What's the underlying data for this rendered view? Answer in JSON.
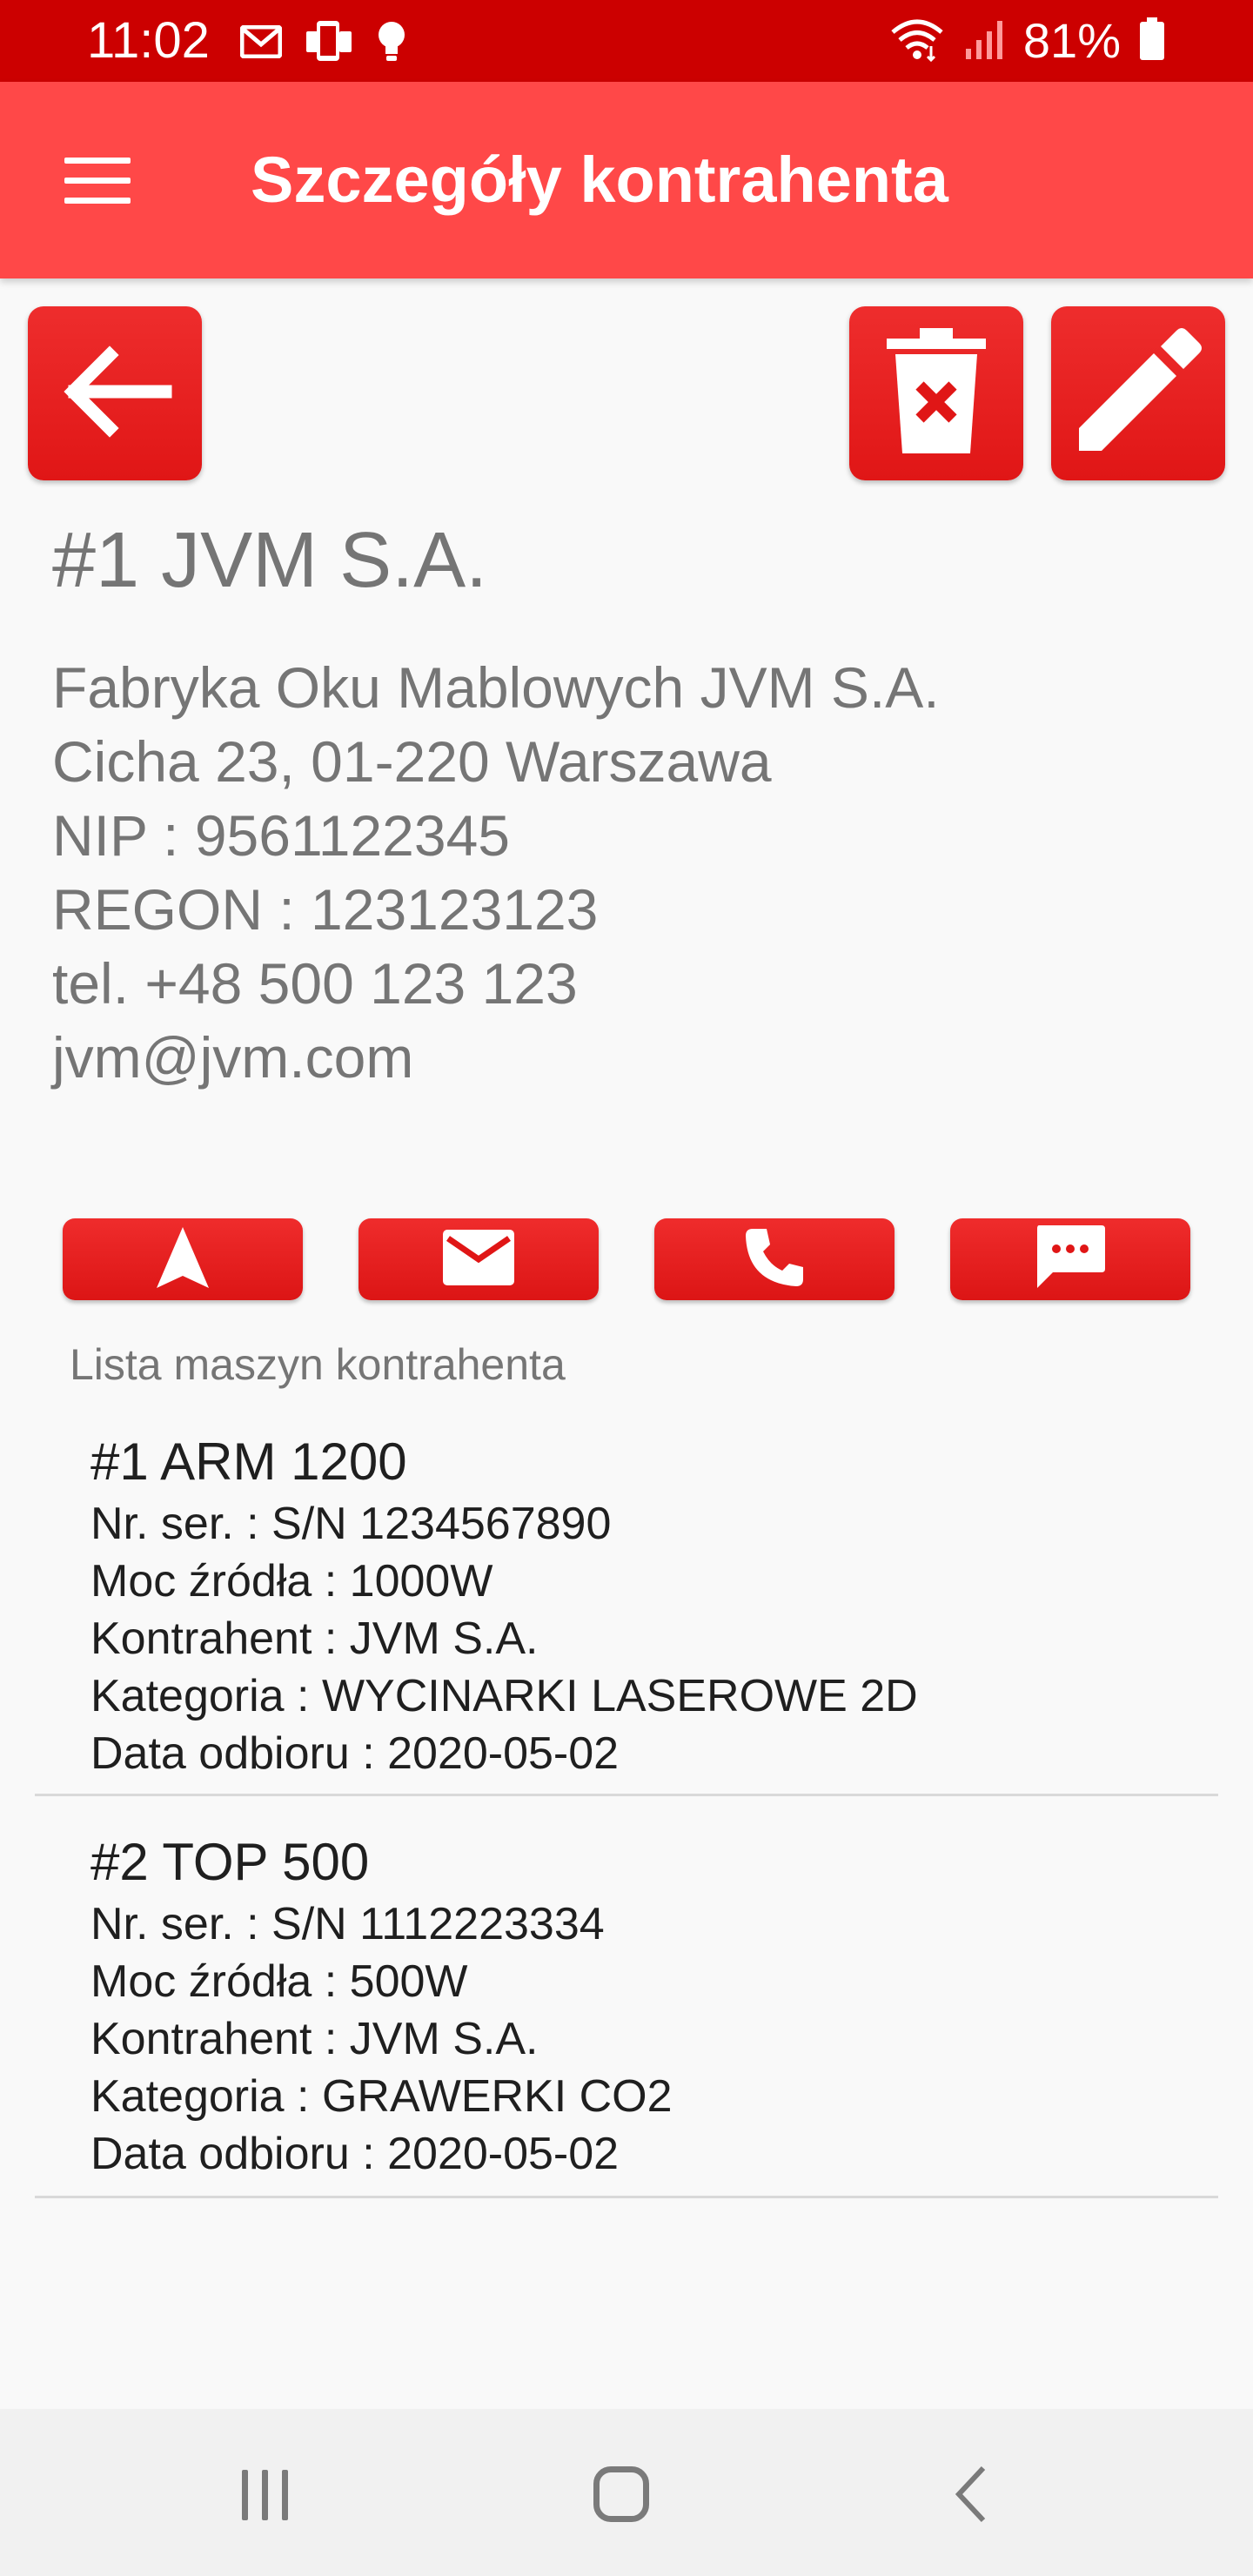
{
  "status_bar": {
    "time": "11:02",
    "battery": "81%",
    "icons": [
      "gmail-icon",
      "phone-link-icon",
      "lightbulb-icon",
      "wifi-icon",
      "signal-icon",
      "battery-icon"
    ]
  },
  "app_bar": {
    "title": "Szczegóły kontrahenta",
    "menu_icon": "hamburger-menu-icon"
  },
  "actions": {
    "back_icon": "arrow-left-icon",
    "delete_icon": "trash-delete-icon",
    "edit_icon": "pencil-edit-icon"
  },
  "contractor": {
    "title": "#1 JVM S.A.",
    "full_name": "Fabryka Oku Mablowych JVM S.A.",
    "address": "Cicha 23, 01-220 Warszawa",
    "nip": "NIP : 9561122345",
    "regon": "REGON : 123123123",
    "phone": "tel. +48 500 123 123",
    "email": "jvm@jvm.com"
  },
  "contact_buttons": {
    "navigate_icon": "navigation-arrow-icon",
    "mail_icon": "envelope-icon",
    "phone_icon": "phone-icon",
    "sms_icon": "message-icon"
  },
  "machines": {
    "header": "Lista maszyn kontrahenta",
    "items": [
      {
        "name": "#1 ARM 1200",
        "serial": "Nr. ser. : S/N 1234567890",
        "power": "Moc źródła : 1000W",
        "contractor": "Kontrahent : JVM S.A.",
        "category": "Kategoria : WYCINARKI LASEROWE 2D",
        "pickup_date": "Data odbioru : 2020-05-02"
      },
      {
        "name": "#2 TOP 500",
        "serial": "Nr. ser. : S/N 1112223334",
        "power": "Moc źródła : 500W",
        "contractor": "Kontrahent : JVM S.A.",
        "category": "Kategoria : GRAWERKI CO2",
        "pickup_date": "Data odbioru : 2020-05-02"
      }
    ]
  },
  "colors": {
    "status_bar": "#cc0000",
    "app_bar": "#ff4848",
    "button": "#e61e1e",
    "background": "#f9f9f9",
    "text_secondary": "#757575",
    "text_primary": "#1f1f1f"
  }
}
